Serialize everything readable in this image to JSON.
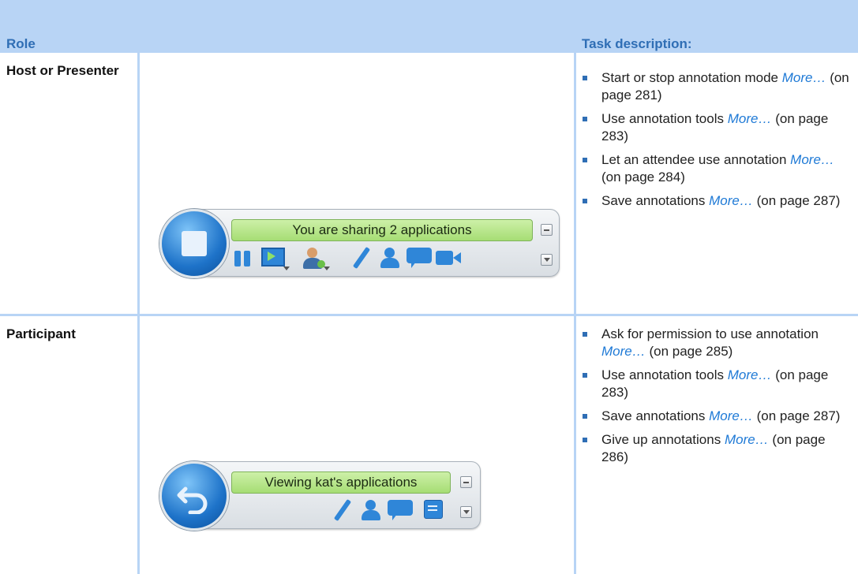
{
  "header": {
    "role_label": "Role",
    "task_label": "Task description:"
  },
  "colors": {
    "accent": "#b8d4f5",
    "heading_text": "#2f6eb5",
    "link": "#1f7ad6",
    "status_green": "#a6dd74"
  },
  "rows": [
    {
      "role": "Host or Presenter",
      "toolbar": {
        "status_text": "You are sharing 2 applications",
        "main_icon": "stop-icon",
        "icons": [
          "pause-icon",
          "monitor-icon",
          "attendee-icon",
          "pen-icon",
          "participants-icon",
          "chat-icon",
          "video-icon"
        ]
      },
      "tasks": [
        {
          "text": "Start or stop annotation mode",
          "link": "More…",
          "ref": "(on page 281)"
        },
        {
          "text": "Use annotation tools",
          "link": "More…",
          "ref": "(on page 283)"
        },
        {
          "text": "Let an attendee use annotation",
          "link": "More…",
          "ref": "(on page 284)"
        },
        {
          "text": "Save annotations",
          "link": "More…",
          "ref": "(on page 287)"
        }
      ]
    },
    {
      "role": "Participant",
      "toolbar": {
        "status_text": "Viewing kat's applications",
        "main_icon": "return-arrow-icon",
        "icons": [
          "pen-icon",
          "participants-icon",
          "chat-icon",
          "notes-icon"
        ]
      },
      "tasks": [
        {
          "text": "Ask for permission to use annotation",
          "link": "More…",
          "ref": "(on page 285)"
        },
        {
          "text": "Use annotation tools",
          "link": "More…",
          "ref": "(on page 283)"
        },
        {
          "text": "Save annotations",
          "link": "More…",
          "ref": "(on page 287)"
        },
        {
          "text": "Give up annotations",
          "link": "More…",
          "ref": "(on page 286)"
        }
      ]
    }
  ]
}
